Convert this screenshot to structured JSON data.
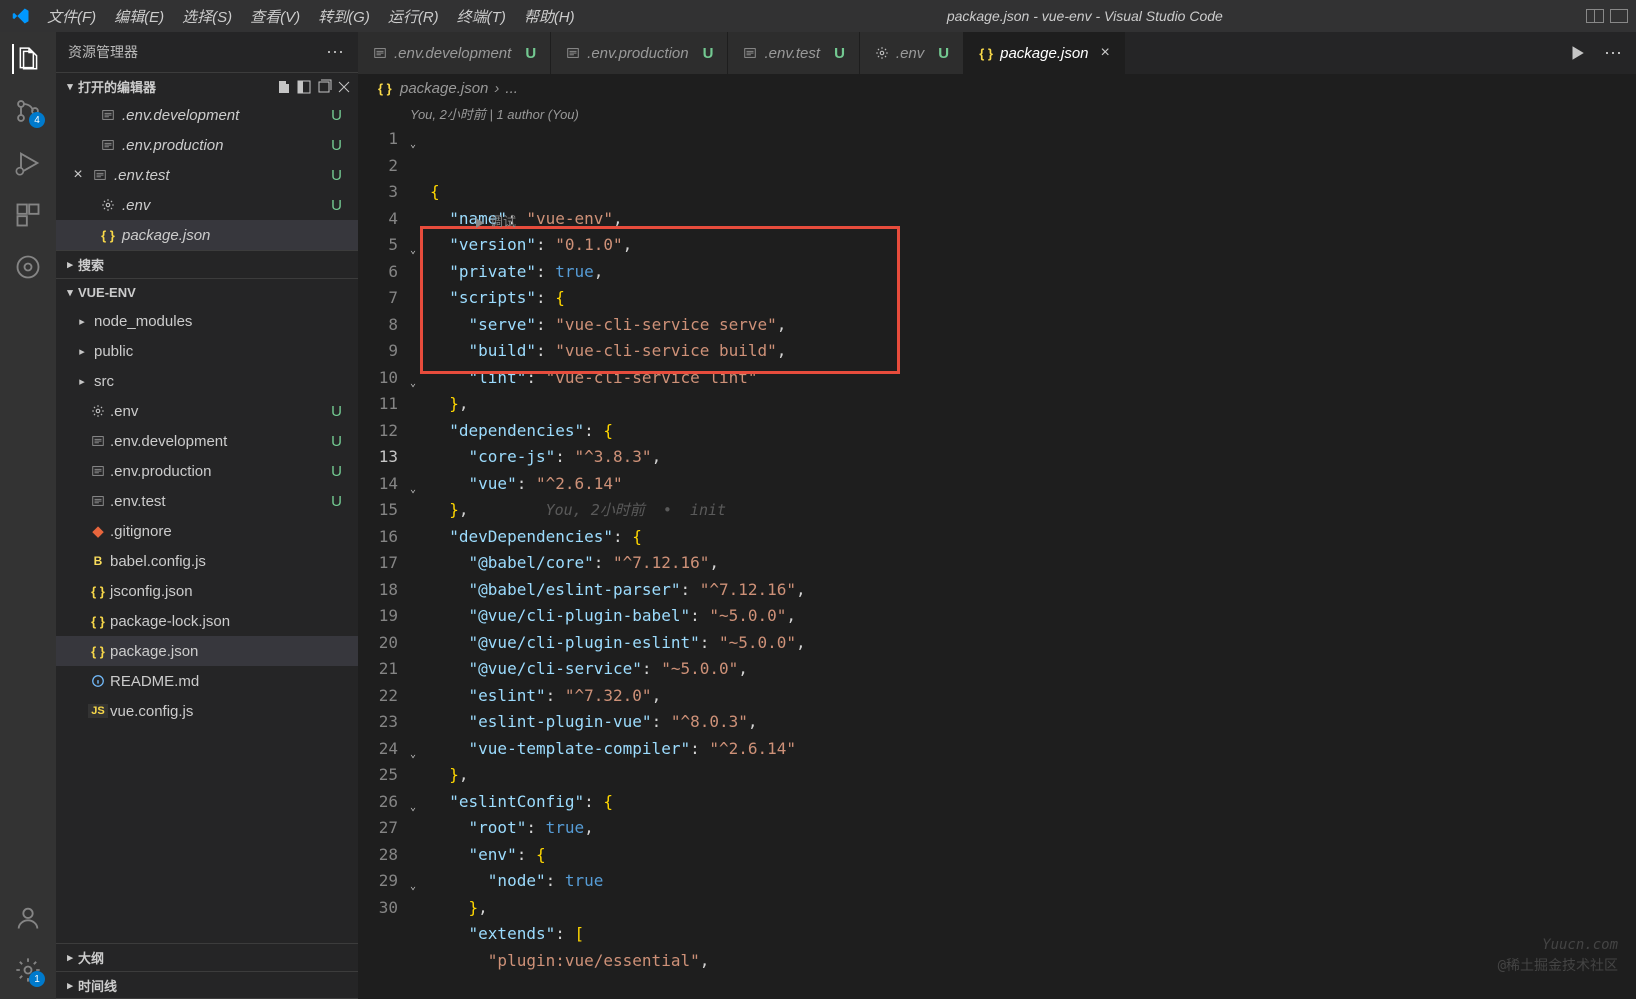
{
  "titlebar": {
    "menus": [
      "文件(F)",
      "编辑(E)",
      "选择(S)",
      "查看(V)",
      "转到(G)",
      "运行(R)",
      "终端(T)",
      "帮助(H)"
    ],
    "title": "package.json - vue-env - Visual Studio Code"
  },
  "activitybar": {
    "badges": {
      "scm": "4",
      "settings": "1"
    }
  },
  "sidebar": {
    "title": "资源管理器",
    "openEditors": {
      "label": "打开的编辑器",
      "items": [
        {
          "name": ".env.development",
          "status": "U",
          "icon": "env"
        },
        {
          "name": ".env.production",
          "status": "U",
          "icon": "env"
        },
        {
          "name": ".env.test",
          "status": "U",
          "icon": "env",
          "close": true
        },
        {
          "name": ".env",
          "status": "U",
          "icon": "gear"
        },
        {
          "name": "package.json",
          "status": "",
          "icon": "json",
          "selected": true
        }
      ]
    },
    "search": {
      "label": "搜索"
    },
    "project": {
      "label": "VUE-ENV",
      "items": [
        {
          "name": "node_modules",
          "type": "folder",
          "indent": 1
        },
        {
          "name": "public",
          "type": "folder",
          "indent": 1
        },
        {
          "name": "src",
          "type": "folder",
          "indent": 1
        },
        {
          "name": ".env",
          "type": "file",
          "icon": "gear",
          "status": "U",
          "indent": 1
        },
        {
          "name": ".env.development",
          "type": "file",
          "icon": "env",
          "status": "U",
          "indent": 1
        },
        {
          "name": ".env.production",
          "type": "file",
          "icon": "env",
          "status": "U",
          "indent": 1
        },
        {
          "name": ".env.test",
          "type": "file",
          "icon": "env",
          "status": "U",
          "indent": 1
        },
        {
          "name": ".gitignore",
          "type": "file",
          "icon": "git",
          "indent": 1
        },
        {
          "name": "babel.config.js",
          "type": "file",
          "icon": "babel",
          "indent": 1
        },
        {
          "name": "jsconfig.json",
          "type": "file",
          "icon": "json",
          "indent": 1
        },
        {
          "name": "package-lock.json",
          "type": "file",
          "icon": "json",
          "indent": 1
        },
        {
          "name": "package.json",
          "type": "file",
          "icon": "json",
          "selected": true,
          "indent": 1
        },
        {
          "name": "README.md",
          "type": "file",
          "icon": "info",
          "indent": 1
        },
        {
          "name": "vue.config.js",
          "type": "file",
          "icon": "js",
          "indent": 1
        }
      ]
    },
    "outline": {
      "label": "大纲"
    },
    "timeline": {
      "label": "时间线"
    }
  },
  "tabs": [
    {
      "name": ".env.development",
      "icon": "env",
      "status": "U"
    },
    {
      "name": ".env.production",
      "icon": "env",
      "status": "U"
    },
    {
      "name": ".env.test",
      "icon": "env",
      "status": "U"
    },
    {
      "name": ".env",
      "icon": "gear",
      "status": "U"
    },
    {
      "name": "package.json",
      "icon": "json",
      "active": true,
      "close": true
    }
  ],
  "breadcrumb": {
    "file": "package.json",
    "rest": "..."
  },
  "codelens": "You, 2小时前 | 1 author (You)",
  "debughint": "调试",
  "blame": "You, 2小时前  •  init",
  "code": {
    "lines": [
      {
        "n": 1,
        "fold": true,
        "tokens": [
          [
            "brace",
            "{"
          ]
        ]
      },
      {
        "n": 2,
        "tokens": [
          [
            "punc",
            "  "
          ],
          [
            "key",
            "\"name\""
          ],
          [
            "punc",
            ": "
          ],
          [
            "str",
            "\"vue-env\""
          ],
          [
            "punc",
            ","
          ]
        ]
      },
      {
        "n": 3,
        "tokens": [
          [
            "punc",
            "  "
          ],
          [
            "key",
            "\"version\""
          ],
          [
            "punc",
            ": "
          ],
          [
            "str",
            "\"0.1.0\""
          ],
          [
            "punc",
            ","
          ]
        ]
      },
      {
        "n": 4,
        "tokens": [
          [
            "punc",
            "  "
          ],
          [
            "key",
            "\"private\""
          ],
          [
            "punc",
            ": "
          ],
          [
            "bool",
            "true"
          ],
          [
            "punc",
            ","
          ]
        ]
      },
      {
        "n": 5,
        "fold": true,
        "debug": true,
        "tokens": [
          [
            "punc",
            "  "
          ],
          [
            "key",
            "\"scripts\""
          ],
          [
            "punc",
            ": "
          ],
          [
            "brace",
            "{"
          ]
        ]
      },
      {
        "n": 6,
        "tokens": [
          [
            "punc",
            "    "
          ],
          [
            "key",
            "\"serve\""
          ],
          [
            "punc",
            ": "
          ],
          [
            "str",
            "\"vue-cli-service serve\""
          ],
          [
            "punc",
            ","
          ]
        ]
      },
      {
        "n": 7,
        "tokens": [
          [
            "punc",
            "    "
          ],
          [
            "key",
            "\"build\""
          ],
          [
            "punc",
            ": "
          ],
          [
            "str",
            "\"vue-cli-service build\""
          ],
          [
            "punc",
            ","
          ]
        ]
      },
      {
        "n": 8,
        "tokens": [
          [
            "punc",
            "    "
          ],
          [
            "key",
            "\"lint\""
          ],
          [
            "punc",
            ": "
          ],
          [
            "str",
            "\"vue-cli-service lint\""
          ]
        ]
      },
      {
        "n": 9,
        "tokens": [
          [
            "punc",
            "  "
          ],
          [
            "brace",
            "}"
          ],
          [
            "punc",
            ","
          ]
        ]
      },
      {
        "n": 10,
        "fold": true,
        "tokens": [
          [
            "punc",
            "  "
          ],
          [
            "key",
            "\"dependencies\""
          ],
          [
            "punc",
            ": "
          ],
          [
            "brace",
            "{"
          ]
        ]
      },
      {
        "n": 11,
        "tokens": [
          [
            "punc",
            "    "
          ],
          [
            "key",
            "\"core-js\""
          ],
          [
            "punc",
            ": "
          ],
          [
            "str",
            "\"^3.8.3\""
          ],
          [
            "punc",
            ","
          ]
        ]
      },
      {
        "n": 12,
        "tokens": [
          [
            "punc",
            "    "
          ],
          [
            "key",
            "\"vue\""
          ],
          [
            "punc",
            ": "
          ],
          [
            "str",
            "\"^2.6.14\""
          ]
        ]
      },
      {
        "n": 13,
        "active": true,
        "blame": true,
        "tokens": [
          [
            "punc",
            "  "
          ],
          [
            "brace",
            "}"
          ],
          [
            "punc",
            ","
          ]
        ]
      },
      {
        "n": 14,
        "fold": true,
        "tokens": [
          [
            "punc",
            "  "
          ],
          [
            "key",
            "\"devDependencies\""
          ],
          [
            "punc",
            ": "
          ],
          [
            "brace",
            "{"
          ]
        ]
      },
      {
        "n": 15,
        "tokens": [
          [
            "punc",
            "    "
          ],
          [
            "key",
            "\"@babel/core\""
          ],
          [
            "punc",
            ": "
          ],
          [
            "str",
            "\"^7.12.16\""
          ],
          [
            "punc",
            ","
          ]
        ]
      },
      {
        "n": 16,
        "tokens": [
          [
            "punc",
            "    "
          ],
          [
            "key",
            "\"@babel/eslint-parser\""
          ],
          [
            "punc",
            ": "
          ],
          [
            "str",
            "\"^7.12.16\""
          ],
          [
            "punc",
            ","
          ]
        ]
      },
      {
        "n": 17,
        "tokens": [
          [
            "punc",
            "    "
          ],
          [
            "key",
            "\"@vue/cli-plugin-babel\""
          ],
          [
            "punc",
            ": "
          ],
          [
            "str",
            "\"~5.0.0\""
          ],
          [
            "punc",
            ","
          ]
        ]
      },
      {
        "n": 18,
        "tokens": [
          [
            "punc",
            "    "
          ],
          [
            "key",
            "\"@vue/cli-plugin-eslint\""
          ],
          [
            "punc",
            ": "
          ],
          [
            "str",
            "\"~5.0.0\""
          ],
          [
            "punc",
            ","
          ]
        ]
      },
      {
        "n": 19,
        "tokens": [
          [
            "punc",
            "    "
          ],
          [
            "key",
            "\"@vue/cli-service\""
          ],
          [
            "punc",
            ": "
          ],
          [
            "str",
            "\"~5.0.0\""
          ],
          [
            "punc",
            ","
          ]
        ]
      },
      {
        "n": 20,
        "tokens": [
          [
            "punc",
            "    "
          ],
          [
            "key",
            "\"eslint\""
          ],
          [
            "punc",
            ": "
          ],
          [
            "str",
            "\"^7.32.0\""
          ],
          [
            "punc",
            ","
          ]
        ]
      },
      {
        "n": 21,
        "tokens": [
          [
            "punc",
            "    "
          ],
          [
            "key",
            "\"eslint-plugin-vue\""
          ],
          [
            "punc",
            ": "
          ],
          [
            "str",
            "\"^8.0.3\""
          ],
          [
            "punc",
            ","
          ]
        ]
      },
      {
        "n": 22,
        "tokens": [
          [
            "punc",
            "    "
          ],
          [
            "key",
            "\"vue-template-compiler\""
          ],
          [
            "punc",
            ": "
          ],
          [
            "str",
            "\"^2.6.14\""
          ]
        ]
      },
      {
        "n": 23,
        "tokens": [
          [
            "punc",
            "  "
          ],
          [
            "brace",
            "}"
          ],
          [
            "punc",
            ","
          ]
        ]
      },
      {
        "n": 24,
        "fold": true,
        "tokens": [
          [
            "punc",
            "  "
          ],
          [
            "key",
            "\"eslintConfig\""
          ],
          [
            "punc",
            ": "
          ],
          [
            "brace",
            "{"
          ]
        ]
      },
      {
        "n": 25,
        "tokens": [
          [
            "punc",
            "    "
          ],
          [
            "key",
            "\"root\""
          ],
          [
            "punc",
            ": "
          ],
          [
            "bool",
            "true"
          ],
          [
            "punc",
            ","
          ]
        ]
      },
      {
        "n": 26,
        "fold": true,
        "tokens": [
          [
            "punc",
            "    "
          ],
          [
            "key",
            "\"env\""
          ],
          [
            "punc",
            ": "
          ],
          [
            "brace",
            "{"
          ]
        ]
      },
      {
        "n": 27,
        "tokens": [
          [
            "punc",
            "      "
          ],
          [
            "key",
            "\"node\""
          ],
          [
            "punc",
            ": "
          ],
          [
            "bool",
            "true"
          ]
        ]
      },
      {
        "n": 28,
        "tokens": [
          [
            "punc",
            "    "
          ],
          [
            "brace",
            "}"
          ],
          [
            "punc",
            ","
          ]
        ]
      },
      {
        "n": 29,
        "fold": true,
        "tokens": [
          [
            "punc",
            "    "
          ],
          [
            "key",
            "\"extends\""
          ],
          [
            "punc",
            ": "
          ],
          [
            "brace",
            "["
          ]
        ]
      },
      {
        "n": 30,
        "tokens": [
          [
            "punc",
            "      "
          ],
          [
            "str",
            "\"plugin:vue/essential\""
          ],
          [
            "punc",
            ","
          ]
        ]
      }
    ]
  },
  "watermarks": {
    "w1": "Yuucn.com",
    "w2": "@稀土掘金技术社区"
  }
}
